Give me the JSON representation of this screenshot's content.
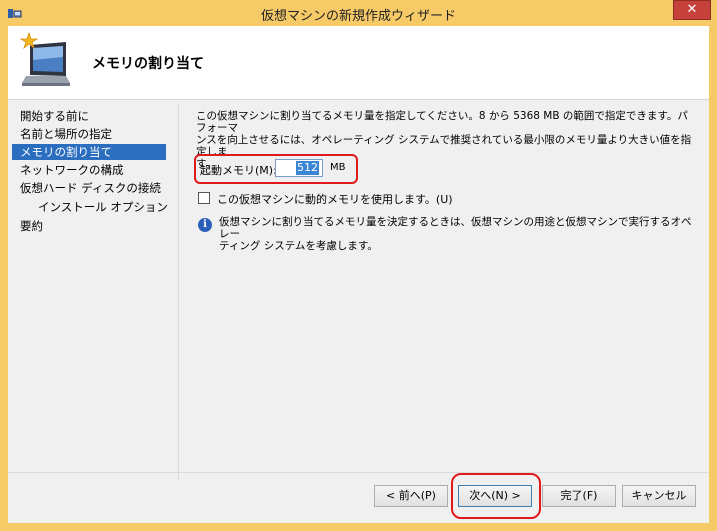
{
  "window": {
    "title": "仮想マシンの新規作成ウィザード",
    "close_label": "✕"
  },
  "header": {
    "title": "メモリの割り当て",
    "icon": "wizard-monitor-icon"
  },
  "nav": {
    "items": [
      {
        "label": "開始する前に",
        "active": false,
        "sub": false
      },
      {
        "label": "名前と場所の指定",
        "active": false,
        "sub": false
      },
      {
        "label": "メモリの割り当て",
        "active": true,
        "sub": false
      },
      {
        "label": "ネットワークの構成",
        "active": false,
        "sub": false
      },
      {
        "label": "仮想ハード ディスクの接続",
        "active": false,
        "sub": false
      },
      {
        "label": "インストール オプション",
        "active": false,
        "sub": true
      },
      {
        "label": "要約",
        "active": false,
        "sub": false
      }
    ]
  },
  "content": {
    "description_line1": "この仮想マシンに割り当てるメモリ量を指定してください。8 から 5368 MB の範囲で指定できます。パフォーマ",
    "description_line2": "ンスを向上させるには、オペレーティング システムで推奨されている最小限のメモリ量より大きい値を指定しま",
    "description_line3": "す。",
    "startup_memory_label": "起動メモリ(M):",
    "startup_memory_value": "512",
    "memory_unit": "MB",
    "dynamic_memory_label": "この仮想マシンに動的メモリを使用します。(U)",
    "dynamic_memory_checked": false,
    "info_line1": "仮想マシンに割り当てるメモリ量を決定するときは、仮想マシンの用途と仮想マシンで実行するオペレー",
    "info_line2": "ティング システムを考慮します。",
    "info_icon": "info-icon"
  },
  "buttons": {
    "back": "< 前へ(P)",
    "next": "次へ(N) >",
    "finish": "完了(F)",
    "cancel": "キャンセル"
  },
  "colors": {
    "titlebar": "#f7ca68",
    "selection": "#2b6ebf",
    "annotation": "#e0191b",
    "close": "#c7413b"
  }
}
